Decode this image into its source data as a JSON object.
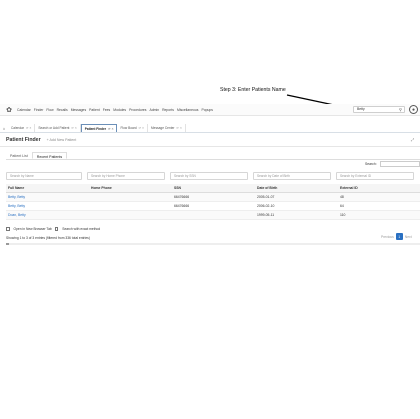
{
  "annotation": {
    "text": "Step 3: Enter Patients Name"
  },
  "nav": {
    "logo_icon": "openemr-logo-icon",
    "menu": [
      "Calendar",
      "Finder",
      "Flow",
      "Recalls",
      "Messages",
      "Patient",
      "Fees",
      "Modules",
      "Procedures",
      "Admin",
      "Reports",
      "Miscellaneous",
      "Popups"
    ],
    "search_value": "Betty",
    "search_icon": "search-icon",
    "user_icon": "user-circle-icon"
  },
  "tabs": [
    {
      "label": "Calendar",
      "active": false
    },
    {
      "label": "Search or Add Patient",
      "active": false
    },
    {
      "label": "Patient Finder",
      "active": true
    },
    {
      "label": "Flow Board",
      "active": false
    },
    {
      "label": "Message Center",
      "active": false
    }
  ],
  "finder": {
    "title": "Patient Finder",
    "add_label": "Add New Patient",
    "subtabs": [
      "Patient List",
      "Recent Patients"
    ],
    "search_label": "Search:",
    "filters": [
      "Search by Name",
      "Search by Home Phone",
      "Search by SSN",
      "Search by Date of Birth",
      "Search by External ID"
    ],
    "columns": [
      "Full Name",
      "Home Phone",
      "SSN",
      "Date of Birth",
      "External ID"
    ],
    "rows": [
      {
        "name": "Betty, Betty",
        "phone": "",
        "ssn": "66476666",
        "dob": "2005-01-07",
        "ext": "48"
      },
      {
        "name": "Betty, Betty",
        "phone": "",
        "ssn": "66476666",
        "dob": "2006-02-10",
        "ext": "64"
      },
      {
        "name": "Doan, Betty",
        "phone": "",
        "ssn": "",
        "dob": "1999-05-11",
        "ext": "110"
      }
    ],
    "option_new_tab": "Open in New Browser Tab",
    "option_exact": "Search with exact method",
    "info": "Showing 1 to 3 of 3 entries (filtered from 336 total entries)",
    "pager": {
      "previous": "Previous",
      "page": "1",
      "next": "Next"
    }
  }
}
